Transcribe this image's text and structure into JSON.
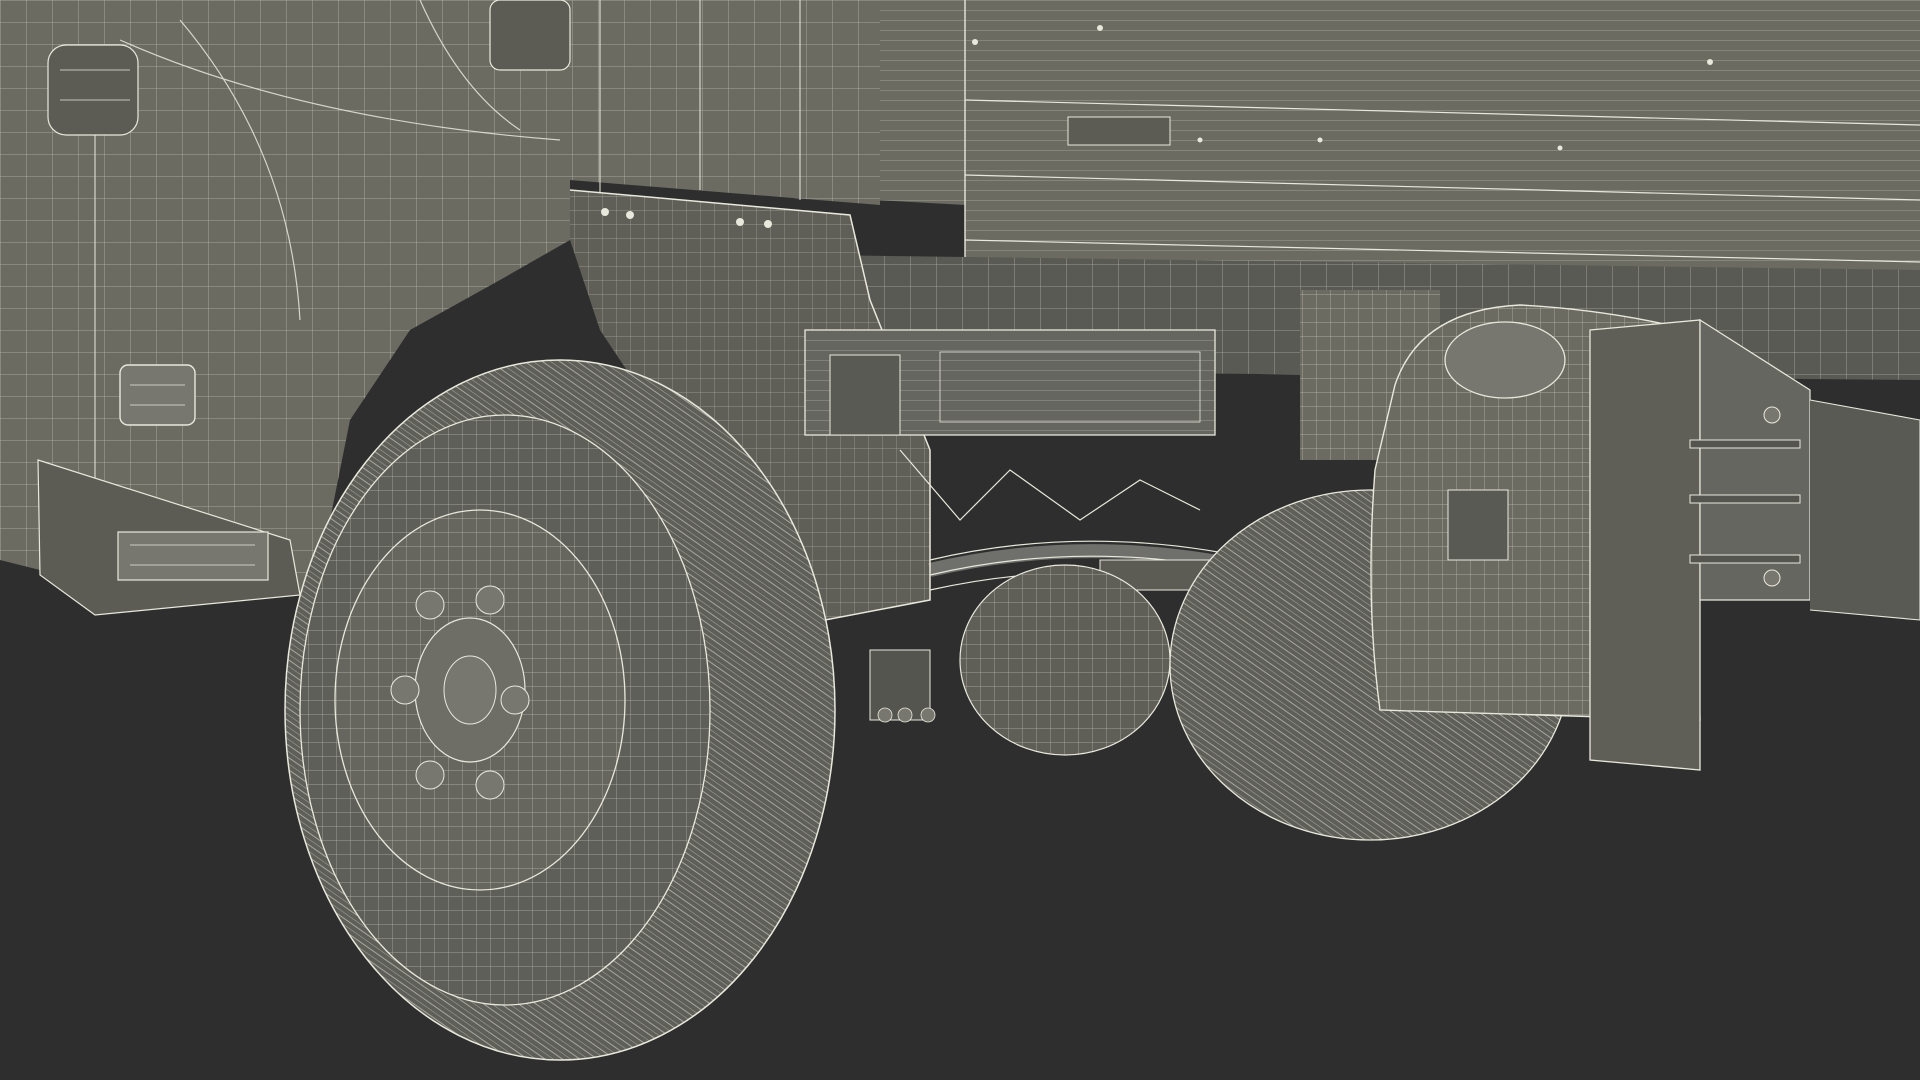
{
  "scene": {
    "subject": "truck-underside-wireframe",
    "background_color": "#2e2e2e",
    "body_color": "#6b6b62",
    "body_shadow_color": "#55554f",
    "wire_color": "#e8e8dc",
    "tire_color": "#5f5f59",
    "view": "perspective-render"
  },
  "parts": {
    "cab": "cab-body",
    "front_wheel": "front-wheel",
    "rear_wheel": "rear-wheel",
    "cargo_box": "cargo-box",
    "fuel_tank": "fuel-tank",
    "mudflap": "mudflap",
    "suspension": "leaf-spring-suspension",
    "fender": "front-fender"
  }
}
